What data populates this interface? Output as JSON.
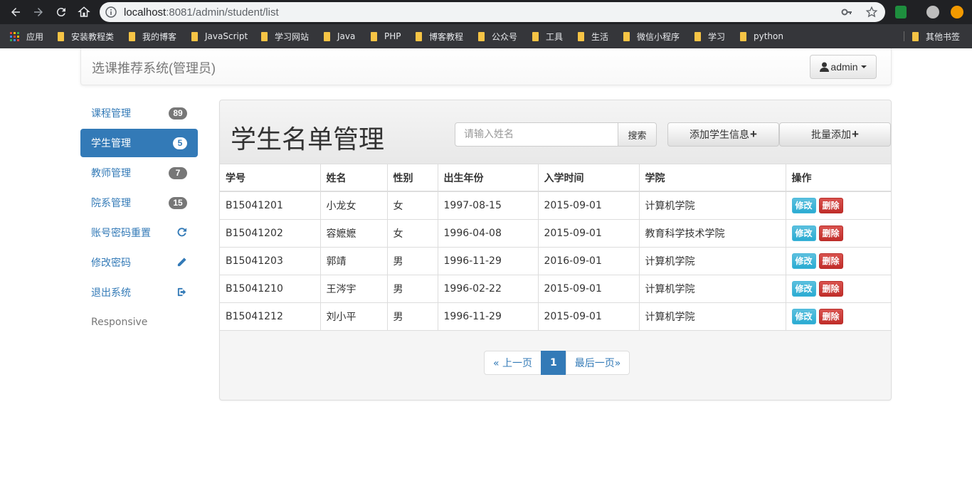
{
  "browser": {
    "url_host": "localhost",
    "url_rest": ":8081/admin/student/list",
    "bookmarks": [
      {
        "label": "应用",
        "type": "apps"
      },
      {
        "label": "安装教程类",
        "type": "folder"
      },
      {
        "label": "我的博客",
        "type": "folder"
      },
      {
        "label": "JavaScript",
        "type": "folder"
      },
      {
        "label": "学习网站",
        "type": "folder"
      },
      {
        "label": "Java",
        "type": "folder"
      },
      {
        "label": "PHP",
        "type": "folder"
      },
      {
        "label": "博客教程",
        "type": "folder"
      },
      {
        "label": "公众号",
        "type": "folder"
      },
      {
        "label": "工具",
        "type": "folder"
      },
      {
        "label": "生活",
        "type": "folder"
      },
      {
        "label": "微信小程序",
        "type": "folder"
      },
      {
        "label": "学习",
        "type": "folder"
      },
      {
        "label": "python",
        "type": "folder"
      }
    ],
    "other_bookmarks": "其他书签"
  },
  "navbar": {
    "brand": "选课推荐系统(管理员)",
    "user": "admin"
  },
  "sidebar": {
    "items": [
      {
        "label": "课程管理",
        "badge": "89",
        "active": false
      },
      {
        "label": "学生管理",
        "badge": "5",
        "active": true
      },
      {
        "label": "教师管理",
        "badge": "7",
        "active": false
      },
      {
        "label": "院系管理",
        "badge": "15",
        "active": false
      },
      {
        "label": "账号密码重置",
        "icon": "refresh-icon"
      },
      {
        "label": "修改密码",
        "icon": "pencil-icon"
      },
      {
        "label": "退出系统",
        "icon": "logout-icon"
      }
    ],
    "responsive_label": "Responsive"
  },
  "panel": {
    "title": "学生名单管理",
    "search_placeholder": "请输入姓名",
    "search_button": "搜索",
    "add_button": "添加学生信息",
    "batch_button": "批量添加"
  },
  "table": {
    "headers": [
      "学号",
      "姓名",
      "性别",
      "出生年份",
      "入学时间",
      "学院",
      "操作"
    ],
    "rows": [
      [
        "B15041201",
        "小龙女",
        "女",
        "1997-08-15",
        "2015-09-01",
        "计算机学院"
      ],
      [
        "B15041202",
        "容嬷嬷",
        "女",
        "1996-04-08",
        "2015-09-01",
        "教育科学技术学院"
      ],
      [
        "B15041203",
        "郭靖",
        "男",
        "1996-11-29",
        "2016-09-01",
        "计算机学院"
      ],
      [
        "B15041210",
        "王涔宇",
        "男",
        "1996-02-22",
        "2015-09-01",
        "计算机学院"
      ],
      [
        "B15041212",
        "刘小平",
        "男",
        "1996-11-29",
        "2015-09-01",
        "计算机学院"
      ]
    ],
    "edit_label": "修改",
    "delete_label": "删除"
  },
  "pagination": {
    "prev": "« 上一页",
    "current": "1",
    "last": "最后一页»"
  },
  "colors": {
    "primary": "#337ab7",
    "info": "#5bc0de",
    "danger": "#d9534f"
  }
}
